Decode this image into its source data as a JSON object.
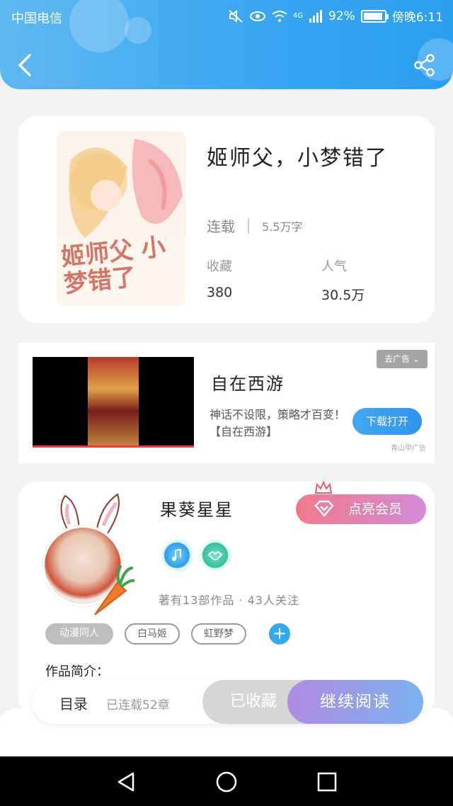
{
  "status_bar": {
    "carrier": "中国电信",
    "battery_pct": "92%",
    "battery_level": 0.92,
    "time": "傍晚6:11",
    "network": "4G"
  },
  "header": {
    "back_icon": "chevron-left-icon",
    "share_icon": "share-icon",
    "colors": {
      "start": "#5fb8f0",
      "end": "#2a9ff2"
    }
  },
  "book": {
    "title": "姬师父，小梦错了",
    "cover_text": "姬师父 小梦错了",
    "status": "连载",
    "word_count": "5.5万字",
    "stats": [
      {
        "label": "收藏",
        "value": "380"
      },
      {
        "label": "人气",
        "value": "30.5万"
      }
    ]
  },
  "ad": {
    "close_label": "去广告",
    "title": "自在西游",
    "description": "神话不设限，策略才百变！【自在西游】",
    "button_label": "下载打开",
    "source": "青山甲广告"
  },
  "author": {
    "name": "果葵星星",
    "vip_button": "点亮会员",
    "badges": [
      "music-note-icon",
      "handshake-icon"
    ],
    "stats": "著有13部作品 · 43人关注",
    "tags": [
      "动漫同人",
      "白马姬",
      "虹野梦"
    ],
    "intro_label": "作品简介："
  },
  "action_bar": {
    "toc_label": "目录",
    "chapters": "已连载52章",
    "collected": "已收藏",
    "continue": "继续阅读"
  },
  "nav": {
    "back": "nav-back-icon",
    "home": "nav-home-icon",
    "recents": "nav-recents-icon"
  }
}
